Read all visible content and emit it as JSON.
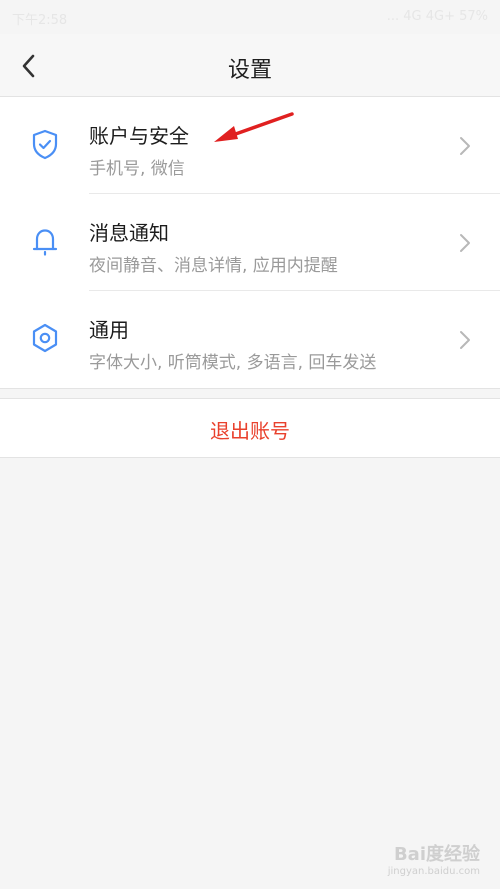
{
  "status_bar": {
    "time": "下午2:58",
    "right_info": "... 4G 4G+ 57%"
  },
  "nav": {
    "title": "设置"
  },
  "items": [
    {
      "icon": "shield-check-icon",
      "title": "账户与安全",
      "subtitle": "手机号, 微信"
    },
    {
      "icon": "bell-icon",
      "title": "消息通知",
      "subtitle": "夜间静音、消息详情, 应用内提醒"
    },
    {
      "icon": "gear-icon",
      "title": "通用",
      "subtitle": "字体大小, 听筒模式, 多语言, 回车发送"
    }
  ],
  "logout": {
    "label": "退出账号"
  },
  "watermark": {
    "main": "Bai度经验",
    "sub": "jingyan.baidu.com"
  },
  "colors": {
    "accent_blue": "#4a8ff5",
    "logout_red": "#e9412d",
    "annotation_red": "#e02020",
    "background": "#f5f5f5"
  }
}
